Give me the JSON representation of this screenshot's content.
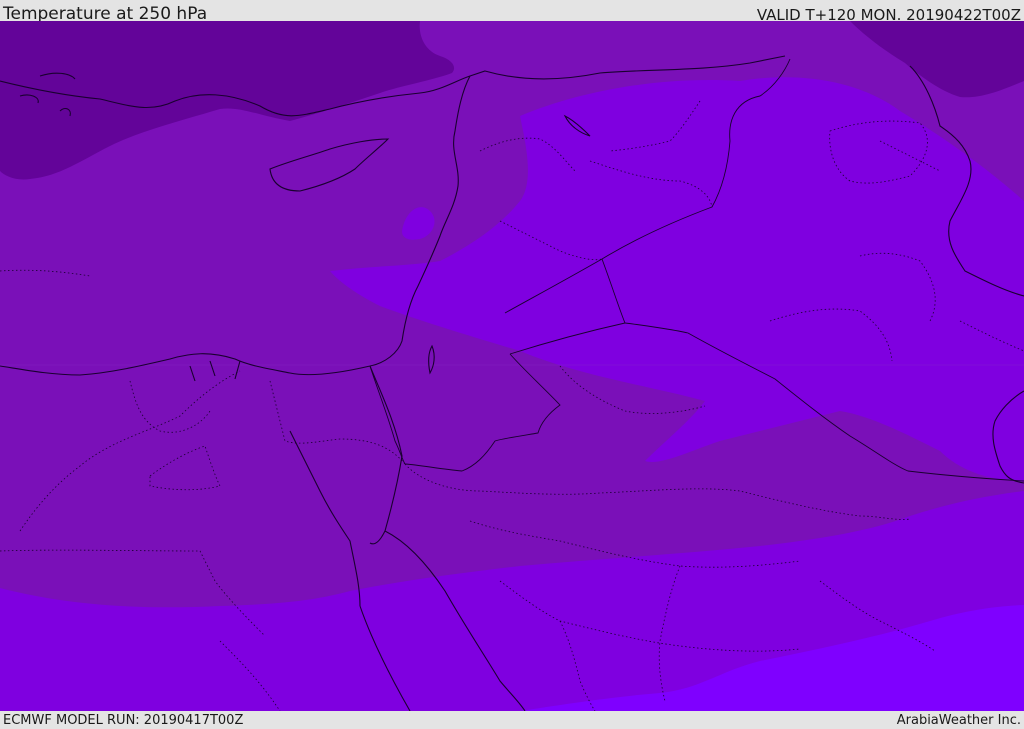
{
  "header": {
    "title": "Temperature at 250 hPa",
    "valid": "VALID T+120 MON. 20190422T00Z"
  },
  "footer": {
    "model_run": "ECMWF MODEL RUN: 20190417T00Z",
    "credit": "ArabiaWeather Inc."
  },
  "colors": {
    "coldest": "#630499",
    "cold": "#7a10b8",
    "mild": "#7f00e0",
    "warm": "#7f00ff",
    "border": "#1a0030"
  }
}
